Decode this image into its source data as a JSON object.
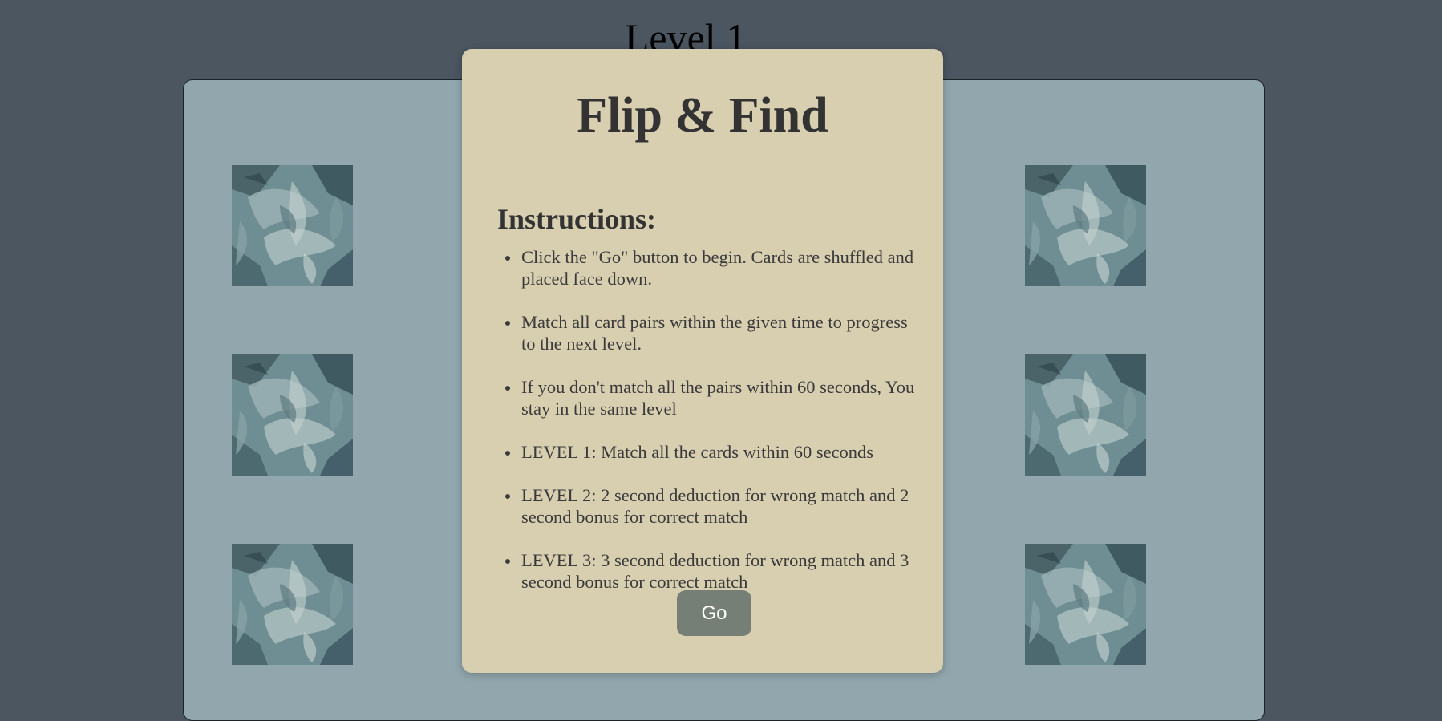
{
  "header": {
    "level_label": "Level 1"
  },
  "board": {
    "background_color": "#91a7ad",
    "card_back_icon": "abstract-teal-pattern",
    "cards_visible": 6
  },
  "modal": {
    "title": "Flip & Find",
    "instructions_heading": "Instructions:",
    "instructions": [
      "Click the \"Go\" button to begin. Cards are shuffled and placed face down.",
      "Match all card pairs within the given time to progress to the next level.",
      "If you don't match all the pairs within 60 seconds, You stay in the same level",
      "LEVEL 1: Match all the cards within 60 seconds",
      "LEVEL 2: 2 second deduction for wrong match and 2 second bonus for correct match",
      "LEVEL 3: 3 second deduction for wrong match and 3 second bonus for correct match"
    ],
    "go_label": "Go",
    "background_color": "#d8ceb0",
    "button_color": "#767f76"
  },
  "page": {
    "background_color": "#4b5661"
  }
}
